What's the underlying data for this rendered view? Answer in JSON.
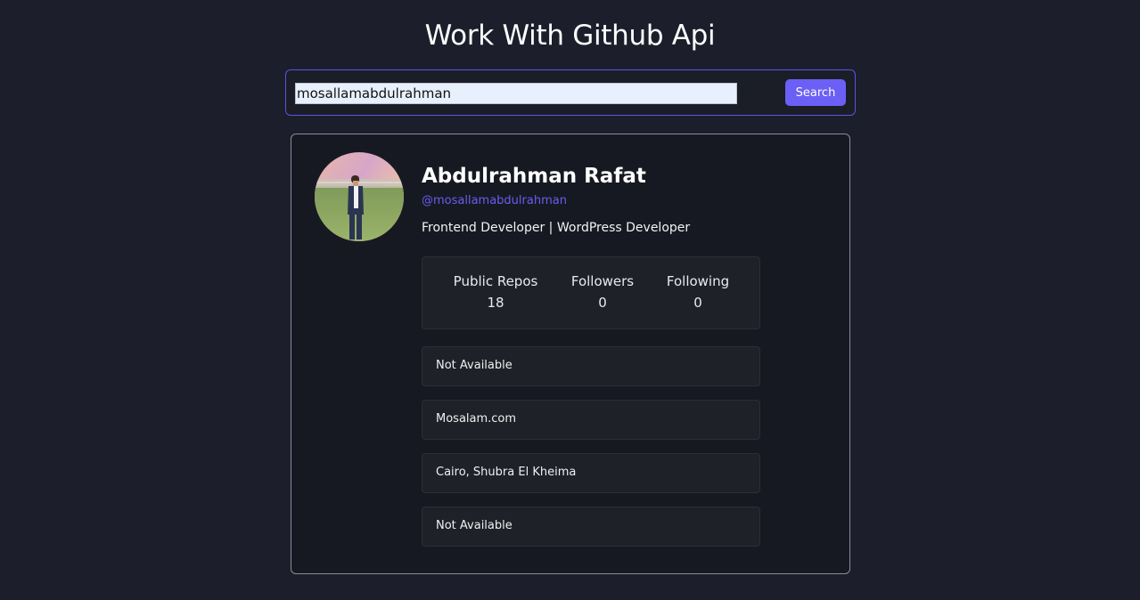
{
  "header": {
    "title": "Work With Github Api"
  },
  "search": {
    "value": "mosallamabdulrahman",
    "button_label": "Search"
  },
  "profile": {
    "name": "Abdulrahman Rafat",
    "login": "@mosallamabdulrahman",
    "bio": "Frontend Developer | WordPress Developer",
    "stats": [
      {
        "label": "Public Repos",
        "value": "18"
      },
      {
        "label": "Followers",
        "value": "0"
      },
      {
        "label": "Following",
        "value": "0"
      }
    ],
    "info": [
      {
        "value": "Not Available"
      },
      {
        "value": "Mosalam.com"
      },
      {
        "value": "Cairo, Shubra El Kheima"
      },
      {
        "value": "Not Available"
      }
    ]
  },
  "colors": {
    "accent": "#6c5ff6",
    "background": "#1c1f2b",
    "card": "#171922"
  }
}
